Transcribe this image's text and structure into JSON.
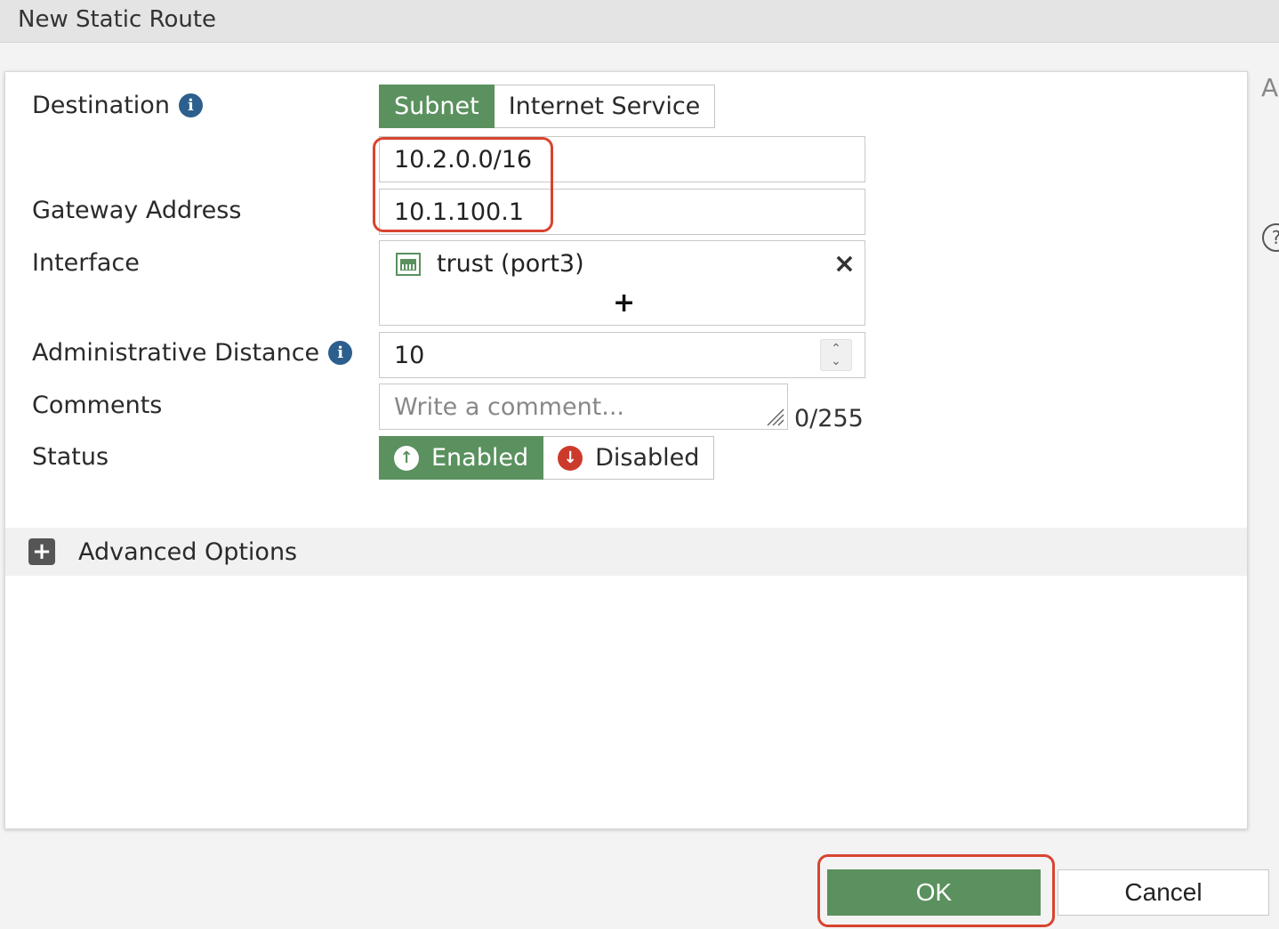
{
  "window": {
    "title": "New Static Route"
  },
  "form": {
    "destination": {
      "label": "Destination",
      "options": [
        "Subnet",
        "Internet Service"
      ],
      "selected": "Subnet",
      "value": "10.2.0.0/16"
    },
    "gateway": {
      "label": "Gateway Address",
      "value": "10.1.100.1"
    },
    "interface": {
      "label": "Interface",
      "selected": "trust (port3)",
      "remove_icon": "×",
      "add_icon": "+"
    },
    "admin_distance": {
      "label": "Administrative Distance",
      "value": "10"
    },
    "comments": {
      "label": "Comments",
      "placeholder": "Write a comment...",
      "counter": "0/255"
    },
    "status": {
      "label": "Status",
      "enabled_label": "Enabled",
      "disabled_label": "Disabled",
      "selected": "Enabled"
    }
  },
  "advanced": {
    "label": "Advanced Options"
  },
  "side": {
    "letter": "A",
    "help": "?"
  },
  "footer": {
    "ok_label": "OK",
    "cancel_label": "Cancel"
  },
  "colors": {
    "accent": "#5a915e",
    "highlight": "#d9442f",
    "info": "#2c5f8d"
  }
}
